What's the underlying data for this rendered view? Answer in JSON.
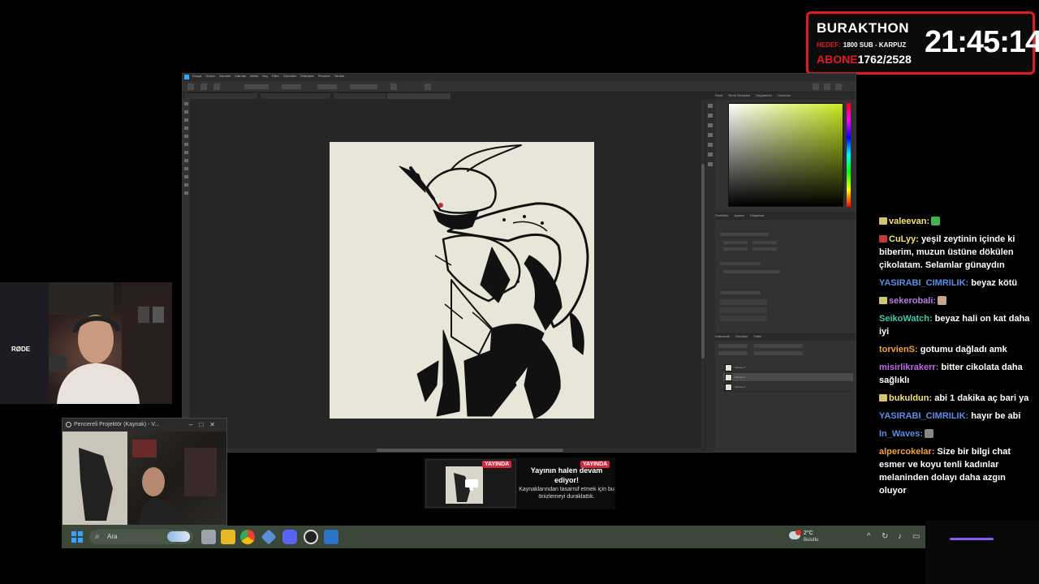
{
  "subathon": {
    "title": "BURAKTHON",
    "goal_label": "HEDEF:",
    "goal_text": "1800 SUB - KARPUZ",
    "count_label": "ABONE",
    "count_value": "1762/2528",
    "timer": "21:45:14",
    "accent_color": "#e01b24"
  },
  "photoshop": {
    "menu": [
      "Dosya",
      "Düzen",
      "Görüntü",
      "Katman",
      "Metin",
      "Seç",
      "Filtre",
      "Görünüm",
      "Eklentiler",
      "Pencere",
      "Yardım"
    ],
    "panel_tabs_top": [
      "Renk",
      "Renk Örnekleri",
      "Degradeler",
      "Desenler"
    ],
    "panel_tabs_mid": [
      "Özellikler",
      "Ayarlar",
      "Kitaplıklar"
    ],
    "panel_tabs_bottom": [
      "Katmanlar",
      "Kanallar",
      "Yollar"
    ],
    "layers": [
      "Katman 2",
      "Katman 1",
      "Katman 0"
    ],
    "selected_layer_index": 1,
    "color_field_hue": "#c7e820"
  },
  "webcam": {
    "mic_label": "RØDE"
  },
  "projector": {
    "title": "Pencereli Projektör (Kaynak) - V..."
  },
  "notice": {
    "badge": "YAYINDA",
    "title": "Yayının halen devam ediyor!",
    "body": "Kaynaklarından tasarruf etmek için bu önizlemeyi duraklattık."
  },
  "taskbar": {
    "search_placeholder": "Ara",
    "weather_temp": "2°C",
    "weather_cond": "Bulutlu",
    "apps": [
      "file-explorer",
      "file-manager",
      "chrome",
      "tool",
      "discord",
      "obs",
      "photoshop"
    ]
  },
  "chat": [
    {
      "user": "valeevan:",
      "color": "#f4e36d",
      "badge": "sub",
      "text": "",
      "emote": "#3fb34f"
    },
    {
      "user": "CuLyy:",
      "color": "#f4e36d",
      "badge": "red",
      "text": "yeşil zeytinin içinde ki biberim, muzun üstüne dökülen çikolatam. Selamlar günaydın"
    },
    {
      "user": "YASIRABI_CIMRILIK:",
      "color": "#5a8fe6",
      "badge": "",
      "text": "beyaz kötü"
    },
    {
      "user": "sekerobali:",
      "color": "#b57be8",
      "badge": "sub",
      "text": "",
      "emote": "#c9a68a"
    },
    {
      "user": "SeikoWatch:",
      "color": "#45c9a8",
      "badge": "",
      "text": "beyaz hali on kat daha iyi"
    },
    {
      "user": "torvienS:",
      "color": "#f0a23a",
      "badge": "",
      "text": "gotumu dağladı amk"
    },
    {
      "user": "misirlikrakerr:",
      "color": "#c069e8",
      "badge": "",
      "text": "bitter cikolata daha sağlıklı"
    },
    {
      "user": "bukuldun:",
      "color": "#f4e36d",
      "badge": "sub",
      "text": "abi 1 dakika aç bari ya"
    },
    {
      "user": "YASIRABI_CIMRILIK:",
      "color": "#5a8fe6",
      "badge": "",
      "text": "hayır be abi"
    },
    {
      "user": "In_Waves:",
      "color": "#5a8fe6",
      "badge": "",
      "text": "",
      "emote": "#888888"
    },
    {
      "user": "alpercokelar:",
      "color": "#f0a23a",
      "badge": "",
      "text": "Size bir bilgi chat esmer ve koyu tenli kadınlar melaninden dolayı daha azgın oluyor"
    }
  ]
}
